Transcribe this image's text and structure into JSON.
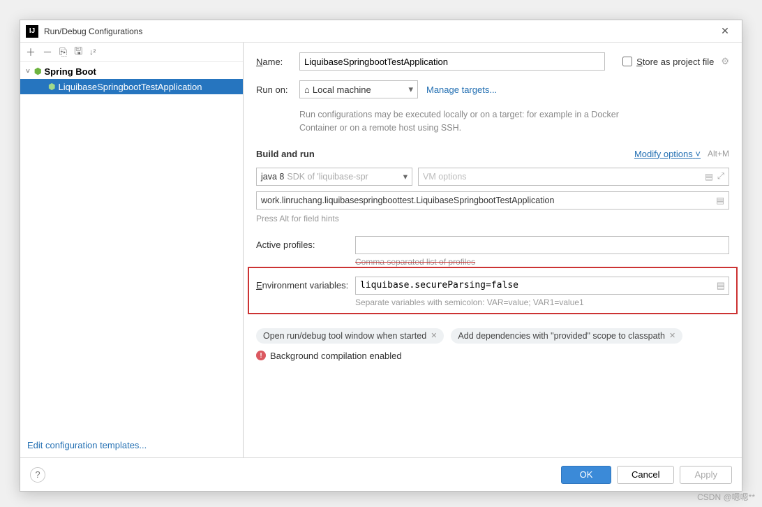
{
  "dialog": {
    "title": "Run/Debug Configurations"
  },
  "tree": {
    "root_label": "Spring Boot",
    "selected_item": "LiquibaseSpringbootTestApplication"
  },
  "sidebar": {
    "edit_templates": "Edit configuration templates..."
  },
  "form": {
    "name_label": "Name:",
    "name_value": "LiquibaseSpringbootTestApplication",
    "store_label": "Store as project file",
    "runon_label": "Run on:",
    "runon_value": "Local machine",
    "manage_targets": "Manage targets...",
    "runon_hint": "Run configurations may be executed locally or on a target: for example in a Docker Container or on a remote host using SSH.",
    "build_title": "Build and run",
    "modify_options": "Modify options",
    "modify_shortcut": "Alt+M",
    "sdk_label": "java 8",
    "sdk_hint": "SDK of 'liquibase-spr",
    "vm_placeholder": "VM options",
    "main_class": "work.linruchang.liquibasespringboottest.LiquibaseSpringbootTestApplication",
    "alt_hint": "Press Alt for field hints",
    "active_profiles_label": "Active profiles:",
    "active_profiles_value": "",
    "active_profiles_hint": "Comma separated list of profiles",
    "env_label": "Environment variables:",
    "env_value": "liquibase.secureParsing=false",
    "env_hint": "Separate variables with semicolon: VAR=value; VAR1=value1",
    "pill1": "Open run/debug tool window when started",
    "pill2": "Add dependencies with \"provided\" scope to classpath",
    "warning": "Background compilation enabled"
  },
  "footer": {
    "ok": "OK",
    "cancel": "Cancel",
    "apply": "Apply"
  },
  "watermark": "CSDN @嗯嗯**"
}
